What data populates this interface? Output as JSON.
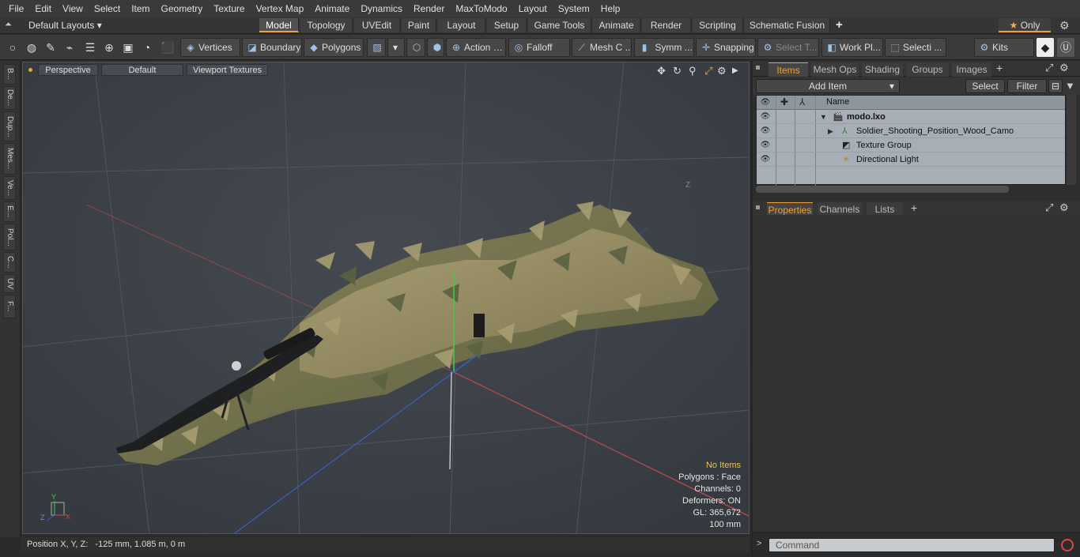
{
  "menu": [
    "File",
    "Edit",
    "View",
    "Select",
    "Item",
    "Geometry",
    "Texture",
    "Vertex Map",
    "Animate",
    "Dynamics",
    "Render",
    "MaxToModo",
    "Layout",
    "System",
    "Help"
  ],
  "layoutbar": {
    "layouts_label": "Default Layouts",
    "tabs": [
      "Model",
      "Topology",
      "UVEdit",
      "Paint",
      "Layout",
      "Setup",
      "Game Tools",
      "Animate",
      "Render",
      "Scripting",
      "Schematic Fusion"
    ],
    "active_tab": "Model",
    "only_label": "Only"
  },
  "toolbar": {
    "vertices": "Vertices",
    "boundary": "Boundary",
    "polygons": "Polygons",
    "action": "Action",
    "falloff": "Falloff",
    "mesh": "Mesh C ...",
    "symm": "Symm ...",
    "snapping": "Snapping",
    "select_t": "Select T...",
    "work_pl": "Work Pl...",
    "selecti": "Selecti ...",
    "kits": "Kits"
  },
  "left_tabs": [
    "B...",
    "De...",
    "Dup...",
    "Mes...",
    "Ve...",
    "E...",
    "Pol...",
    "C...",
    "UV",
    "F..."
  ],
  "viewport": {
    "view_mode": "Perspective",
    "shading": "Default",
    "textures": "Viewport Textures",
    "info": {
      "items": "No Items",
      "polygons": "Polygons : Face",
      "channels": "Channels: 0",
      "deformers": "Deformers: ON",
      "gl": "GL: 365,672",
      "scale": "100 mm"
    },
    "axis_label_z": "Z",
    "gizmo": {
      "x": "X",
      "y": "Y",
      "z": "Z"
    }
  },
  "status": {
    "position_label": "Position X, Y, Z:",
    "position_value": "-125 mm, 1.085 m, 0 m"
  },
  "right": {
    "top_tabs": [
      "Items",
      "Mesh Ops",
      "Shading",
      "Groups",
      "Images"
    ],
    "active_top_tab": "Items",
    "add_item": "Add Item",
    "select_btn": "Select",
    "filter_btn": "Filter",
    "name_col": "Name",
    "items": [
      {
        "name": "modo.lxo",
        "bold": true
      },
      {
        "name": "Soldier_Shooting_Position_Wood_Camo",
        "bold": false
      },
      {
        "name": "Texture Group",
        "bold": false
      },
      {
        "name": "Directional Light",
        "bold": false
      }
    ],
    "bottom_tabs": [
      "Properties",
      "Channels",
      "Lists"
    ],
    "active_bottom_tab": "Properties",
    "command_placeholder": "Command"
  },
  "colors": {
    "accent": "#e8a33d",
    "viewport_bg": "#3d4248",
    "info_highlight": "#f0c040"
  }
}
